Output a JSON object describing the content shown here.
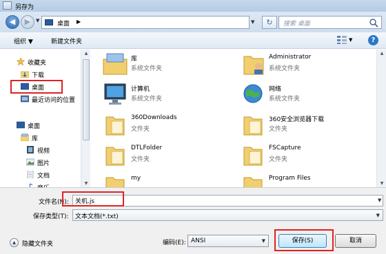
{
  "window": {
    "title": "另存为"
  },
  "address_bar": {
    "location": "桌面",
    "search_placeholder": "搜索 桌面"
  },
  "toolbar": {
    "organize": "组织 ▼",
    "new_folder": "新建文件夹"
  },
  "sidebar": {
    "items": [
      {
        "label": "收藏夹",
        "icon": "star-icon"
      },
      {
        "label": "下载",
        "icon": "download-folder-icon"
      },
      {
        "label": "桌面",
        "icon": "desktop-icon"
      },
      {
        "label": "最近访问的位置",
        "icon": "recent-places-icon"
      },
      {
        "label": "桌面",
        "icon": "desktop-icon"
      },
      {
        "label": "库",
        "icon": "library-icon"
      },
      {
        "label": "视频",
        "icon": "video-icon"
      },
      {
        "label": "图片",
        "icon": "picture-icon"
      },
      {
        "label": "文档",
        "icon": "document-icon"
      },
      {
        "label": "音乐",
        "icon": "music-icon"
      }
    ]
  },
  "files": [
    {
      "name": "库",
      "type": "系统文件夹",
      "icon": "library-icon"
    },
    {
      "name": "Administrator",
      "type": "系统文件夹",
      "icon": "user-folder-icon"
    },
    {
      "name": "计算机",
      "type": "系统文件夹",
      "icon": "computer-icon"
    },
    {
      "name": "网络",
      "type": "系统文件夹",
      "icon": "network-icon"
    },
    {
      "name": "360Downloads",
      "type": "文件夹",
      "icon": "folder-icon"
    },
    {
      "name": "360安全浏览器下载",
      "type": "文件夹",
      "icon": "folder-icon"
    },
    {
      "name": "DTLFolder",
      "type": "文件夹",
      "icon": "folder-icon"
    },
    {
      "name": "FSCapture",
      "type": "文件夹",
      "icon": "folder-icon"
    },
    {
      "name": "my",
      "type": "",
      "icon": "folder-icon"
    },
    {
      "name": "Program Files",
      "type": "",
      "icon": "folder-icon"
    }
  ],
  "form": {
    "filename_label": "文件名(N):",
    "filename_value": "关机.js",
    "filetype_label": "保存类型(T):",
    "filetype_value": "文本文档(*.txt)",
    "hide_folders": "隐藏文件夹",
    "encoding_label": "编码(E):",
    "encoding_value": "ANSI",
    "save": "保存(S)",
    "cancel": "取消"
  },
  "colors": {
    "highlight_box": "#e02020",
    "accent": "#2a65ad"
  }
}
